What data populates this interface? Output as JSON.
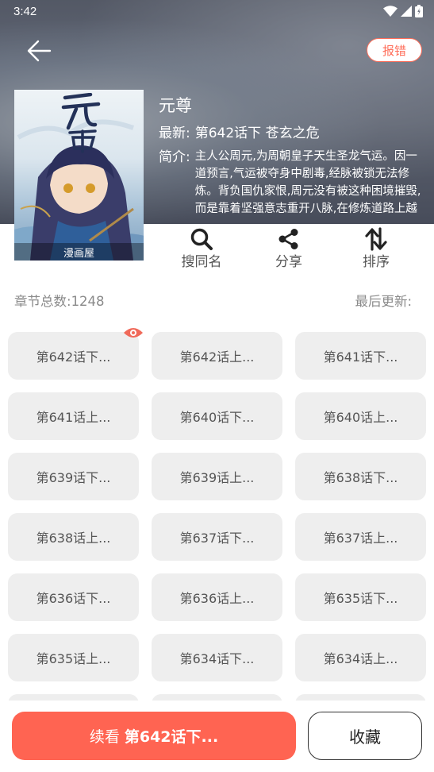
{
  "status_bar": {
    "time": "3:42"
  },
  "header": {
    "report_label": "报错"
  },
  "comic": {
    "title": "元尊",
    "latest_label": "最新:",
    "latest_value": "第642话下 苍玄之危",
    "intro_label": "简介:",
    "intro_text": "主人公周元,为周朝皇子天生圣龙气运。因一道预言,气运被夺身中剧毒,经脉被锁无法修炼。背负国仇家恨,周元没有被这种困境摧毁,而是靠着坚强意志重开八脉,在修炼道路上越走越远……",
    "cover_title": "元尊",
    "cover_source": "漫画屋"
  },
  "actions": [
    {
      "label": "搜同名",
      "icon": "search-icon"
    },
    {
      "label": "分享",
      "icon": "share-icon"
    },
    {
      "label": "排序",
      "icon": "sort-icon"
    }
  ],
  "meta": {
    "chapter_count_label": "章节总数:",
    "chapter_count": "1248",
    "last_update_label": "最后更新:"
  },
  "chapters": [
    "第642话下...",
    "第642话上...",
    "第641话下...",
    "第641话上...",
    "第640话下...",
    "第640话上...",
    "第639话下...",
    "第639话上...",
    "第638话下...",
    "第638话上...",
    "第637话下...",
    "第637话上...",
    "第636话下...",
    "第636话上...",
    "第635话下...",
    "第635话上...",
    "第634话下...",
    "第634话上...",
    "",
    "",
    ""
  ],
  "bottom": {
    "continue_prefix": "续看",
    "continue_chapter": "第642话下...",
    "favorite_label": "收藏"
  },
  "colors": {
    "accent": "#ff6452",
    "chip_bg": "#eeeeee"
  }
}
